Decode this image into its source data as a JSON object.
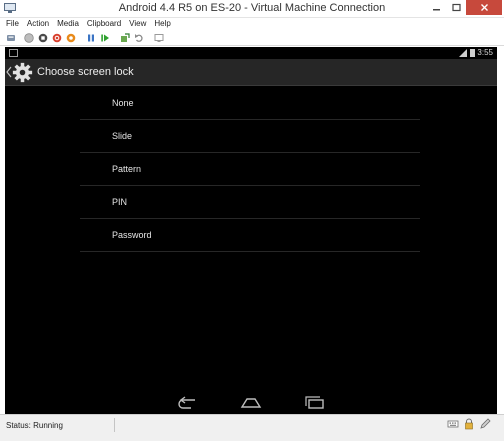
{
  "window": {
    "title": "Android 4.4 R5 on ES-20 - Virtual Machine Connection",
    "app_icon": "vm-connection-icon",
    "controls": [
      "minimize-icon",
      "restore-icon",
      "close-icon"
    ]
  },
  "menu": {
    "items": [
      {
        "label": "File"
      },
      {
        "label": "Action"
      },
      {
        "label": "Media"
      },
      {
        "label": "Clipboard"
      },
      {
        "label": "View"
      },
      {
        "label": "Help"
      }
    ]
  },
  "toolbar": {
    "icons": [
      "ctrl-alt-del-icon",
      "start-icon",
      "turn-off-icon",
      "shut-down-icon",
      "save-icon",
      "pause-icon",
      "resume-icon",
      "checkpoint-icon",
      "revert-icon",
      "enhanced-session-icon"
    ]
  },
  "android": {
    "status_bar": {
      "time": "3:55"
    },
    "action_bar": {
      "title": "Choose screen lock"
    },
    "options": [
      {
        "label": "None"
      },
      {
        "label": "Slide"
      },
      {
        "label": "Pattern"
      },
      {
        "label": "PIN"
      },
      {
        "label": "Password"
      }
    ],
    "nav": [
      "back-icon",
      "home-icon",
      "recent-apps-icon"
    ]
  },
  "status": {
    "text": "Status: Running",
    "tray_icons": [
      "keyboard-icon",
      "lock-icon",
      "pen-icon"
    ]
  },
  "colors": {
    "screen_bg": "#000000",
    "action_bar_bg": "#262626",
    "close_button": "#c7493c",
    "text_light": "#e6e6e6"
  }
}
